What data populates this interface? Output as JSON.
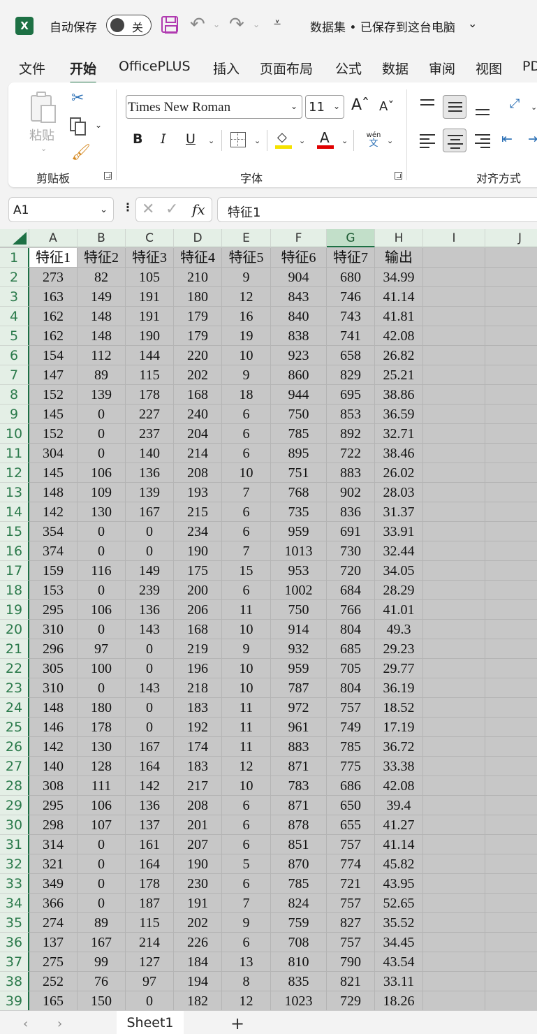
{
  "titlebar": {
    "autosave_label": "自动保存",
    "toggle_state": "关",
    "doc_title": "数据集 • 已保存到这台电脑",
    "doc_chevron": "⌄",
    "undo_glyph": "↶",
    "redo_glyph": "↷",
    "customize_glyph": "⩡"
  },
  "tabs": [
    "文件",
    "开始",
    "OfficePLUS",
    "插入",
    "页面布局",
    "公式",
    "数据",
    "审阅",
    "视图",
    "PD"
  ],
  "active_tab": "开始",
  "ribbon": {
    "clipboard_label": "剪贴板",
    "paste_label": "粘贴",
    "font_group_label": "字体",
    "align_group_label": "对齐方式",
    "font_name": "Times New Roman",
    "font_size": "11",
    "bold": "B",
    "italic": "I",
    "underline": "U",
    "pinyin_top": "wén",
    "pinyin_bottom": "文"
  },
  "formula_bar": {
    "name_box": "A1",
    "formula": "特征1",
    "fx": "fx"
  },
  "columns": [
    "A",
    "B",
    "C",
    "D",
    "E",
    "F",
    "G",
    "H",
    "I",
    "J"
  ],
  "selected_column": "G",
  "header_row": [
    "特征1",
    "特征2",
    "特征3",
    "特征4",
    "特征5",
    "特征6",
    "特征7",
    "输出"
  ],
  "rows": [
    [
      "273",
      "82",
      "105",
      "210",
      "9",
      "904",
      "680",
      "34.99"
    ],
    [
      "163",
      "149",
      "191",
      "180",
      "12",
      "843",
      "746",
      "41.14"
    ],
    [
      "162",
      "148",
      "191",
      "179",
      "16",
      "840",
      "743",
      "41.81"
    ],
    [
      "162",
      "148",
      "190",
      "179",
      "19",
      "838",
      "741",
      "42.08"
    ],
    [
      "154",
      "112",
      "144",
      "220",
      "10",
      "923",
      "658",
      "26.82"
    ],
    [
      "147",
      "89",
      "115",
      "202",
      "9",
      "860",
      "829",
      "25.21"
    ],
    [
      "152",
      "139",
      "178",
      "168",
      "18",
      "944",
      "695",
      "38.86"
    ],
    [
      "145",
      "0",
      "227",
      "240",
      "6",
      "750",
      "853",
      "36.59"
    ],
    [
      "152",
      "0",
      "237",
      "204",
      "6",
      "785",
      "892",
      "32.71"
    ],
    [
      "304",
      "0",
      "140",
      "214",
      "6",
      "895",
      "722",
      "38.46"
    ],
    [
      "145",
      "106",
      "136",
      "208",
      "10",
      "751",
      "883",
      "26.02"
    ],
    [
      "148",
      "109",
      "139",
      "193",
      "7",
      "768",
      "902",
      "28.03"
    ],
    [
      "142",
      "130",
      "167",
      "215",
      "6",
      "735",
      "836",
      "31.37"
    ],
    [
      "354",
      "0",
      "0",
      "234",
      "6",
      "959",
      "691",
      "33.91"
    ],
    [
      "374",
      "0",
      "0",
      "190",
      "7",
      "1013",
      "730",
      "32.44"
    ],
    [
      "159",
      "116",
      "149",
      "175",
      "15",
      "953",
      "720",
      "34.05"
    ],
    [
      "153",
      "0",
      "239",
      "200",
      "6",
      "1002",
      "684",
      "28.29"
    ],
    [
      "295",
      "106",
      "136",
      "206",
      "11",
      "750",
      "766",
      "41.01"
    ],
    [
      "310",
      "0",
      "143",
      "168",
      "10",
      "914",
      "804",
      "49.3"
    ],
    [
      "296",
      "97",
      "0",
      "219",
      "9",
      "932",
      "685",
      "29.23"
    ],
    [
      "305",
      "100",
      "0",
      "196",
      "10",
      "959",
      "705",
      "29.77"
    ],
    [
      "310",
      "0",
      "143",
      "218",
      "10",
      "787",
      "804",
      "36.19"
    ],
    [
      "148",
      "180",
      "0",
      "183",
      "11",
      "972",
      "757",
      "18.52"
    ],
    [
      "146",
      "178",
      "0",
      "192",
      "11",
      "961",
      "749",
      "17.19"
    ],
    [
      "142",
      "130",
      "167",
      "174",
      "11",
      "883",
      "785",
      "36.72"
    ],
    [
      "140",
      "128",
      "164",
      "183",
      "12",
      "871",
      "775",
      "33.38"
    ],
    [
      "308",
      "111",
      "142",
      "217",
      "10",
      "783",
      "686",
      "42.08"
    ],
    [
      "295",
      "106",
      "136",
      "208",
      "6",
      "871",
      "650",
      "39.4"
    ],
    [
      "298",
      "107",
      "137",
      "201",
      "6",
      "878",
      "655",
      "41.27"
    ],
    [
      "314",
      "0",
      "161",
      "207",
      "6",
      "851",
      "757",
      "41.14"
    ],
    [
      "321",
      "0",
      "164",
      "190",
      "5",
      "870",
      "774",
      "45.82"
    ],
    [
      "349",
      "0",
      "178",
      "230",
      "6",
      "785",
      "721",
      "43.95"
    ],
    [
      "366",
      "0",
      "187",
      "191",
      "7",
      "824",
      "757",
      "52.65"
    ],
    [
      "274",
      "89",
      "115",
      "202",
      "9",
      "759",
      "827",
      "35.52"
    ],
    [
      "137",
      "167",
      "214",
      "226",
      "6",
      "708",
      "757",
      "34.45"
    ],
    [
      "275",
      "99",
      "127",
      "184",
      "13",
      "810",
      "790",
      "43.54"
    ],
    [
      "252",
      "76",
      "97",
      "194",
      "8",
      "835",
      "821",
      "33.11"
    ],
    [
      "165",
      "150",
      "0",
      "182",
      "12",
      "1023",
      "729",
      "18.26"
    ]
  ],
  "sheet_tabs": [
    "Sheet1"
  ],
  "colors": {
    "excel_green": "#1d7044",
    "header_bg": "#e4efe6",
    "grid_bg": "#c7c7c7",
    "fill_yellow": "#f5e200",
    "font_red": "#e00000"
  }
}
